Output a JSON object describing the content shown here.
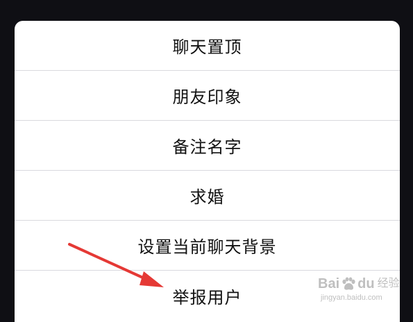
{
  "menu": {
    "items": [
      {
        "label": "聊天置顶"
      },
      {
        "label": "朋友印象"
      },
      {
        "label": "备注名字"
      },
      {
        "label": "求婚"
      },
      {
        "label": "设置当前聊天背景"
      },
      {
        "label": "举报用户"
      }
    ]
  },
  "annotation": {
    "arrow_color": "#e53935"
  },
  "watermark": {
    "brand_left": "Bai",
    "brand_right": "du",
    "brand_cn": "经验",
    "url": "jingyan.baidu.com"
  },
  "colors": {
    "background": "#0f0f14",
    "sheet": "#ffffff",
    "divider": "#d9d9de",
    "text": "#111111"
  }
}
